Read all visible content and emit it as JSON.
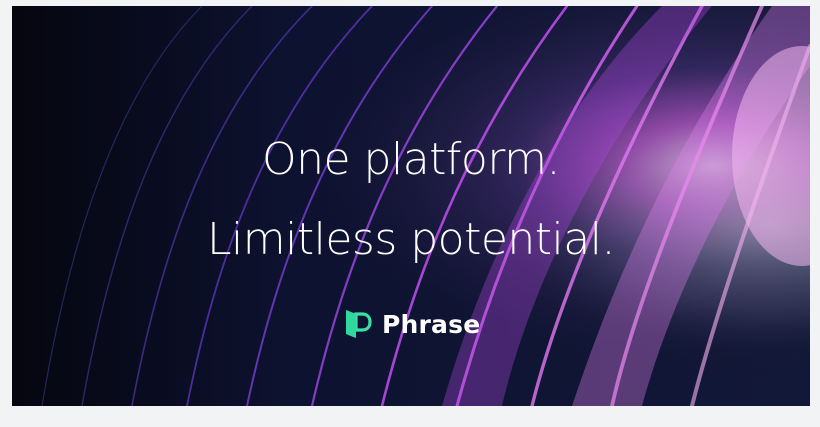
{
  "hero": {
    "headline_line1": "One platform.",
    "headline_line2": "Limitless potential."
  },
  "brand": {
    "name": "Phrase",
    "logo_icon": "phrase-logo-icon",
    "logo_color": "#38e0a8"
  },
  "colors": {
    "background": "#0a0d1e",
    "accent_purple": "#c44cf0",
    "accent_pink": "#f0a0e8",
    "text": "#ffffff"
  }
}
